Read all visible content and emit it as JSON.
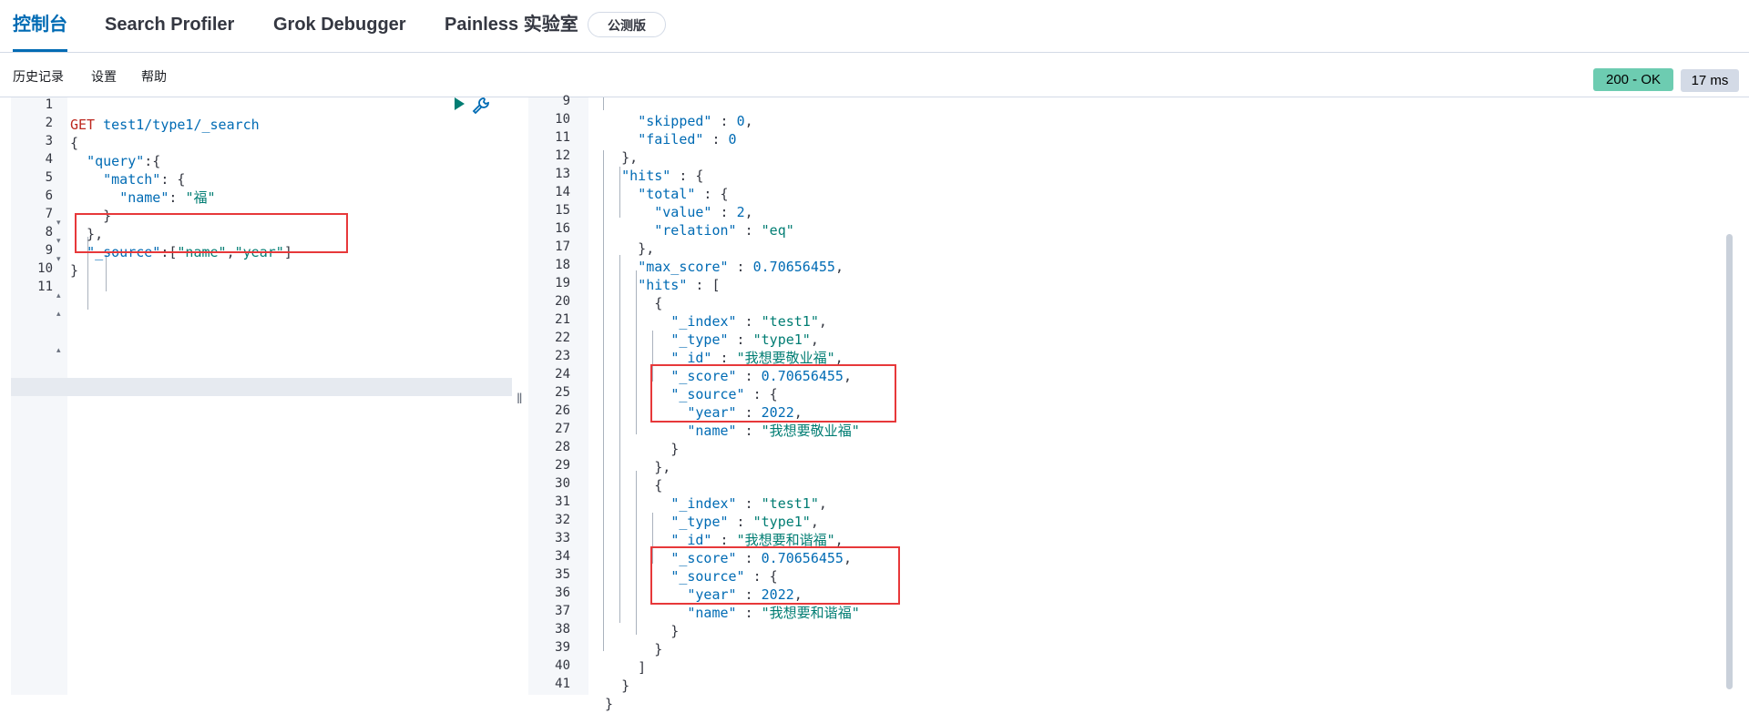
{
  "tabs": [
    {
      "label": "控制台"
    },
    {
      "label": "Search Profiler"
    },
    {
      "label": "Grok Debugger"
    },
    {
      "label": "Painless 实验室"
    }
  ],
  "beta_badge": "公测版",
  "menu": {
    "history": "历史记录",
    "settings": "设置",
    "help": "帮助"
  },
  "status": {
    "code": "200 - OK",
    "time": "17 ms"
  },
  "request": {
    "method": "GET",
    "path": "test1/type1/_search",
    "line_numbers": [
      "1",
      "2",
      "3",
      "4",
      "5",
      "6",
      "7",
      "8",
      "9",
      "10",
      "11"
    ]
  },
  "response": {
    "line_numbers": [
      "9",
      "10",
      "11",
      "12",
      "13",
      "14",
      "15",
      "16",
      "17",
      "18",
      "19",
      "20",
      "21",
      "22",
      "23",
      "24",
      "25",
      "26",
      "27",
      "28",
      "29",
      "30",
      "31",
      "32",
      "33",
      "34",
      "35",
      "36",
      "37",
      "38",
      "39",
      "40",
      "41"
    ]
  },
  "icons": {
    "run": "play-icon",
    "settings": "wrench-icon"
  }
}
